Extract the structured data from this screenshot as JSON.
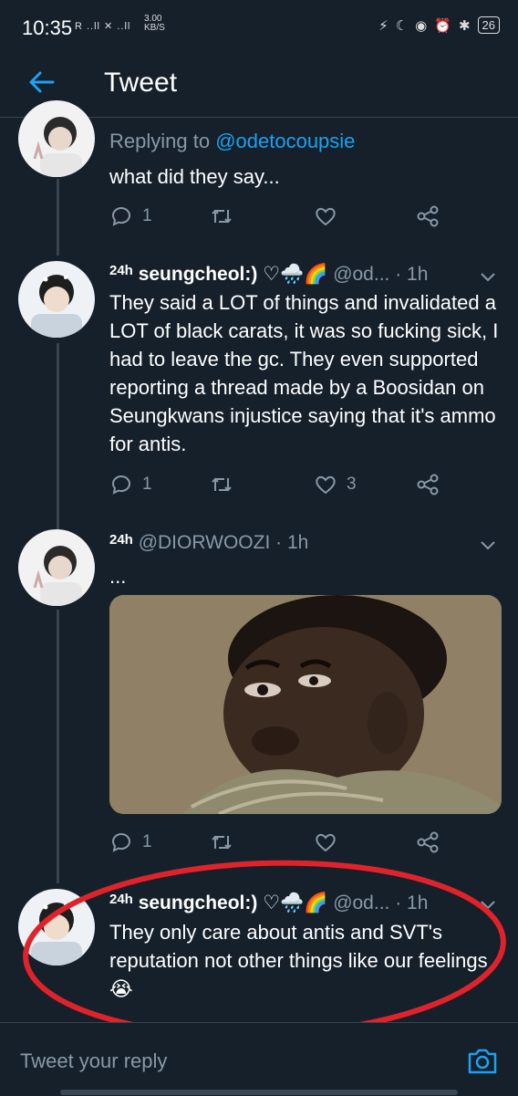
{
  "status": {
    "time": "10:35",
    "network": "R ..ll ✕ ..ll",
    "speed_value": "3.00",
    "speed_unit": "KB/S",
    "battery": "26"
  },
  "header": {
    "title": "Tweet"
  },
  "tweets": [
    {
      "replying_label": "Replying to",
      "replying_handle": "@odetocoupsie",
      "text": "what did they say...",
      "reply_count": "1",
      "retweet_count": "",
      "like_count": ""
    },
    {
      "badge": "24h",
      "display_name": "seungcheol:) ♡🌧️🌈",
      "handle_time": "@od... · 1h",
      "text": "They said a LOT of things and invalidated a LOT of black carats, it was so fucking sick, I had to leave the gc. They even supported reporting a thread made by a Boosidan on Seungkwans injustice saying that it's ammo for antis.",
      "reply_count": "1",
      "retweet_count": "",
      "like_count": "3"
    },
    {
      "badge": "24h",
      "handle_time": "@DIORWOOZI · 1h",
      "text": "...",
      "reply_count": "1",
      "retweet_count": "",
      "like_count": ""
    },
    {
      "badge": "24h",
      "display_name": "seungcheol:) ♡🌧️🌈",
      "handle_time": "@od... · 1h",
      "text": "They only care about antis and SVT's reputation not other things like our feelings😭"
    }
  ],
  "reply_bar": {
    "placeholder": "Tweet your reply"
  },
  "colors": {
    "background": "#15202b",
    "accent": "#1da1f2",
    "muted_text": "#8899a6",
    "divider": "#38444d",
    "annotation": "#e0232b"
  }
}
